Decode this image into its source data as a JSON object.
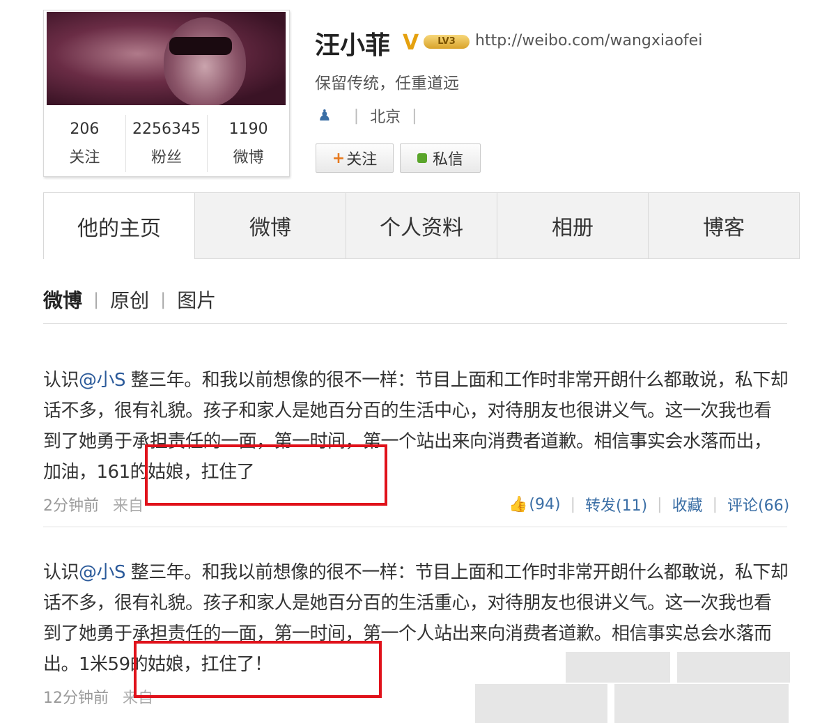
{
  "profile": {
    "name": "汪小菲",
    "verified_mark": "V",
    "level_badge": "LV3",
    "url": "http://weibo.com/wangxiaofei",
    "motto": "保留传统，任重道远",
    "location": "北京",
    "follow_label": "关注",
    "message_label": "私信",
    "stats": [
      {
        "value": "206",
        "label": "关注"
      },
      {
        "value": "2256345",
        "label": "粉丝"
      },
      {
        "value": "1190",
        "label": "微博"
      }
    ]
  },
  "tabs": [
    "他的主页",
    "微博",
    "个人资料",
    "相册",
    "博客"
  ],
  "subtabs": [
    "微博",
    "原创",
    "图片"
  ],
  "posts": [
    {
      "prefix": "认识",
      "mention": "@小S",
      "text": " 整三年。和我以前想像的很不一样：节目上面和工作时非常开朗什么都敢说，私下却话不多，很有礼貌。孩子和家人是她百分百的生活中心，对待朋友也很讲义气。这一次我也看到了她勇于承担责任的一面，第一时间，第一个站出来向消费者道歉。相信事实会水落而出，加油，161的姑娘，扛住了",
      "time": "2分钟前",
      "source": "来自",
      "likes": "(94)",
      "forward": "转发(11)",
      "favorite": "收藏",
      "comment": "评论(66)"
    },
    {
      "prefix": "认识",
      "mention": "@小S",
      "text": " 整三年。和我以前想像的很不一样：节目上面和工作时非常开朗什么都敢说，私下却话不多，很有礼貌。孩子和家人是她百分百的生活重心，对待朋友也很讲义气。这一次我也看到了她勇于承担责任的一面，第一时间，第一个人站出来向消费者道歉。相信事实总会水落而出。1米59的姑娘，扛住了！",
      "time": "12分钟前",
      "source": "来自"
    }
  ],
  "colors": {
    "highlight": "#e0121b",
    "link": "#2b5a9a",
    "verified": "#e5a10f"
  }
}
